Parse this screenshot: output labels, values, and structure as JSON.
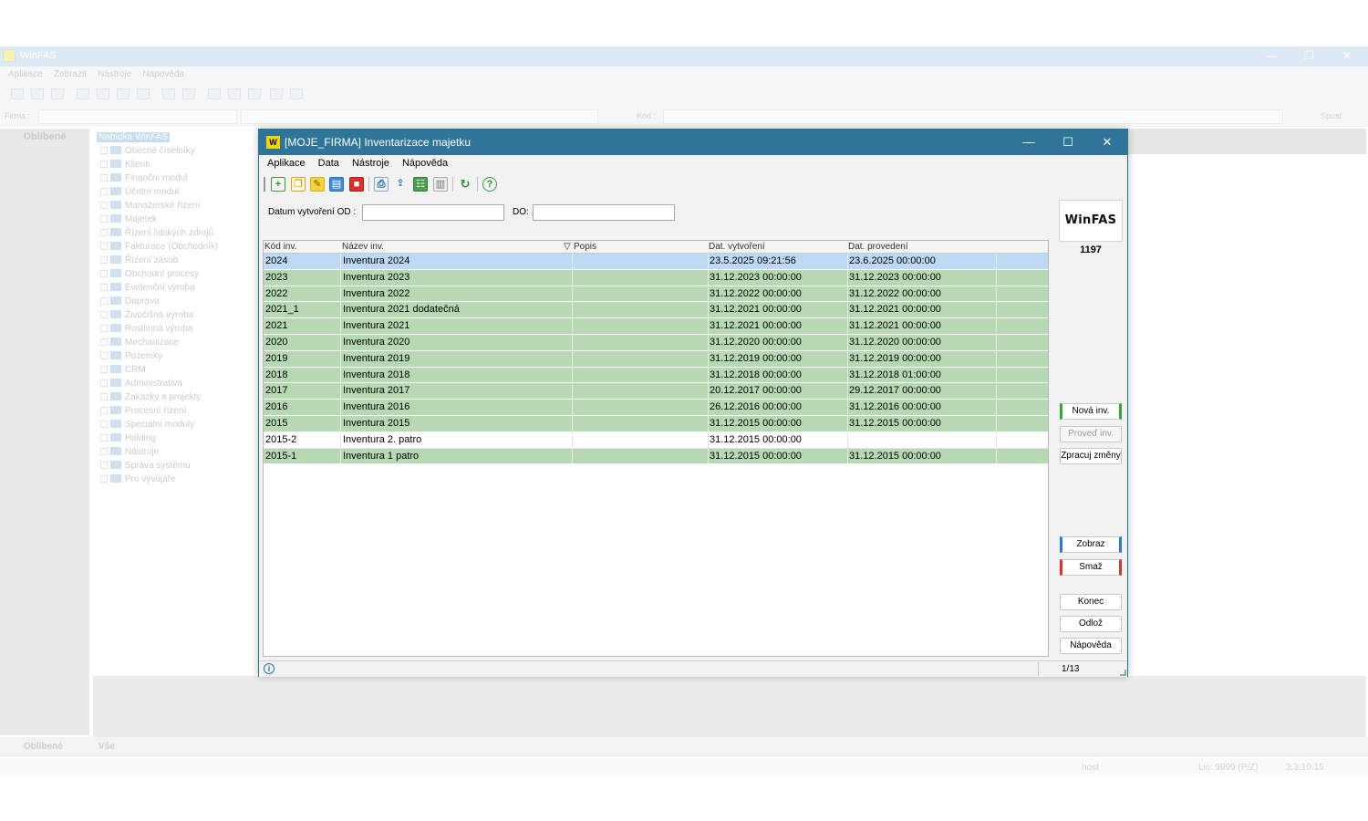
{
  "background_app": {
    "title": "WinFAS",
    "menu": [
      "Aplikace",
      "Zobrazit",
      "Nástroje",
      "Nápověda"
    ],
    "firma_label": "Firma :",
    "kod_label": "Kód :",
    "spust_label": "Spusť",
    "left_panel_title": "Oblíbené",
    "tree_root": "Nabídka WinFAS",
    "tree_items": [
      "Obecné číselníky",
      "Klienti",
      "Finanční modul",
      "Účetní modul",
      "Manažerské řízení",
      "Majetek",
      "Řízení lidských zdrojů",
      "Fakturace (Obchodník)",
      "Řízení zásob",
      "Obchodní procesy",
      "Evidenční výroba",
      "Doprava",
      "Živočišná výroba",
      "Rostlinná výroba",
      "Mechanizace",
      "Pozemky",
      "CRM",
      "Administrativa",
      "Zakázky a projekty",
      "Procesní řízení",
      "Speciální moduly",
      "Holding",
      "Nástroje",
      "Správa systému",
      "Pro vývojáře"
    ],
    "bottom_tabs": [
      "Oblíbené",
      "Vše"
    ],
    "status_user": "host",
    "status_lic": "Lic: 9999 (P/Z)",
    "status_version": "3.3.10.15"
  },
  "dialog": {
    "logo_glyph": "W",
    "title": "[MOJE_FIRMA] Inventarizace majetku",
    "window_controls": {
      "minimize": "—",
      "maximize": "☐",
      "close": "✕"
    },
    "menu": [
      "Aplikace",
      "Data",
      "Nástroje",
      "Nápověda"
    ],
    "filter": {
      "from_label": "Datum vytvoření OD :",
      "from_value": "",
      "to_label": "DO:",
      "to_value": ""
    },
    "grid": {
      "columns": [
        "Kód inv.",
        "Název inv.",
        "Popis",
        "Dat. vytvoření",
        "Dat. provedení"
      ],
      "filter_glyph": "▽",
      "rows": [
        {
          "kod": "2024",
          "nazev": "Inventura 2024",
          "popis": "",
          "vytvoreni": "23.5.2025 09:21:56",
          "provedeni": "23.6.2025 00:00:00",
          "state": "selected"
        },
        {
          "kod": "2023",
          "nazev": "Inventura 2023",
          "popis": "",
          "vytvoreni": "31.12.2023 00:00:00",
          "provedeni": "31.12.2023 00:00:00",
          "state": "green"
        },
        {
          "kod": "2022",
          "nazev": "Inventura 2022",
          "popis": "",
          "vytvoreni": "31.12.2022 00:00:00",
          "provedeni": "31.12.2022 00:00:00",
          "state": "green"
        },
        {
          "kod": "2021_1",
          "nazev": "Inventura 2021 dodatečná",
          "popis": "",
          "vytvoreni": "31.12.2021 00:00:00",
          "provedeni": "31.12.2021 00:00:00",
          "state": "green"
        },
        {
          "kod": "2021",
          "nazev": "Inventura 2021",
          "popis": "",
          "vytvoreni": "31.12.2021 00:00:00",
          "provedeni": "31.12.2021 00:00:00",
          "state": "green"
        },
        {
          "kod": "2020",
          "nazev": "Inventura 2020",
          "popis": "",
          "vytvoreni": "31.12.2020 00:00:00",
          "provedeni": "31.12.2020 00:00:00",
          "state": "green"
        },
        {
          "kod": "2019",
          "nazev": "Inventura 2019",
          "popis": "",
          "vytvoreni": "31.12.2019 00:00:00",
          "provedeni": "31.12.2019 00:00:00",
          "state": "green"
        },
        {
          "kod": "2018",
          "nazev": "Inventura 2018",
          "popis": "",
          "vytvoreni": "31.12.2018 00:00:00",
          "provedeni": "31.12.2018 01:00:00",
          "state": "green"
        },
        {
          "kod": "2017",
          "nazev": "Inventura 2017",
          "popis": "",
          "vytvoreni": "20.12.2017 00:00:00",
          "provedeni": "29.12.2017 00:00:00",
          "state": "green"
        },
        {
          "kod": "2016",
          "nazev": "Inventura 2016",
          "popis": "",
          "vytvoreni": "26.12.2016 00:00:00",
          "provedeni": "31.12.2016 00:00:00",
          "state": "green"
        },
        {
          "kod": "2015",
          "nazev": "Inventura 2015",
          "popis": "",
          "vytvoreni": "31.12.2015 00:00:00",
          "provedeni": "31.12.2015 00:00:00",
          "state": "green"
        },
        {
          "kod": "2015-2",
          "nazev": "Inventura 2. patro",
          "popis": "",
          "vytvoreni": "31.12.2015 00:00:00",
          "provedeni": "",
          "state": "white"
        },
        {
          "kod": "2015-1",
          "nazev": "Inventura 1 patro",
          "popis": "",
          "vytvoreni": "31.12.2015 00:00:00",
          "provedeni": "31.12.2015 00:00:00",
          "state": "green"
        }
      ]
    },
    "right_panel": {
      "logo_text": "WinFAS",
      "count": "1197",
      "buttons": {
        "nova_inv": "Nová inv.",
        "proved_inv": "Proveď inv.",
        "zpracuj_zmeny": "Zpracuj změny",
        "zobraz": "Zobraz",
        "smaz": "Smaž",
        "konec": "Konec",
        "odloz": "Odlož",
        "napoveda": "Nápověda"
      }
    },
    "status": {
      "info_glyph": "i",
      "pager": "1/13"
    }
  },
  "colors": {
    "dialog_titlebar": "#2e7599",
    "row_green": "#b6d8b3",
    "row_selected": "#bcdaf3",
    "accent_green": "#3aa445",
    "accent_blue": "#2a7bd0",
    "accent_red": "#d8342e"
  }
}
